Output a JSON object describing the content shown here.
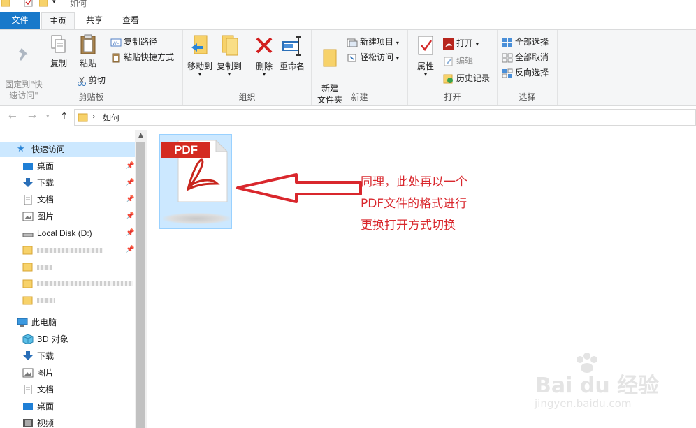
{
  "window": {
    "title": "如何"
  },
  "tabs": {
    "file": "文件",
    "home": "主页",
    "share": "共享",
    "view": "查看"
  },
  "ribbon": {
    "clipboard": {
      "label": "剪贴板",
      "pin_quick_access": "固定到\"快\n速访问\"",
      "copy": "复制",
      "paste": "粘贴",
      "copy_path": "复制路径",
      "paste_shortcut": "粘贴快捷方式",
      "cut": "剪切"
    },
    "organize": {
      "label": "组织",
      "move_to": "移动到",
      "copy_to": "复制到",
      "delete": "删除",
      "rename": "重命名"
    },
    "new": {
      "label": "新建",
      "new_folder": "新建\n文件夹",
      "new_item": "新建项目",
      "easy_access": "轻松访问"
    },
    "open": {
      "label": "打开",
      "properties": "属性",
      "open": "打开",
      "edit": "编辑",
      "history": "历史记录"
    },
    "select": {
      "label": "选择",
      "select_all": "全部选择",
      "select_none": "全部取消",
      "invert": "反向选择"
    }
  },
  "address": {
    "path": "如何"
  },
  "nav": {
    "quick_access": "快速访问",
    "desktop": "桌面",
    "downloads": "下载",
    "documents": "文档",
    "pictures": "图片",
    "local_disk": "Local Disk (D:)",
    "this_pc": "此电脑",
    "objects3d": "3D 对象",
    "pc_downloads": "下载",
    "pc_pictures": "图片",
    "pc_documents": "文档",
    "pc_desktop": "桌面",
    "videos": "视频"
  },
  "file": {
    "badge": "PDF",
    "icon": "pdf-file-icon"
  },
  "annotation": {
    "line1": "同理，此处再以一个",
    "line2": "PDF文件的格式进行",
    "line3": "更换打开方式切换"
  },
  "watermark": {
    "brand": "Bai du 经验",
    "url": "jingyen.baidu.com"
  },
  "colors": {
    "file_tab": "#1979ca",
    "selection": "#cce8ff",
    "annotation": "#d9272d"
  }
}
